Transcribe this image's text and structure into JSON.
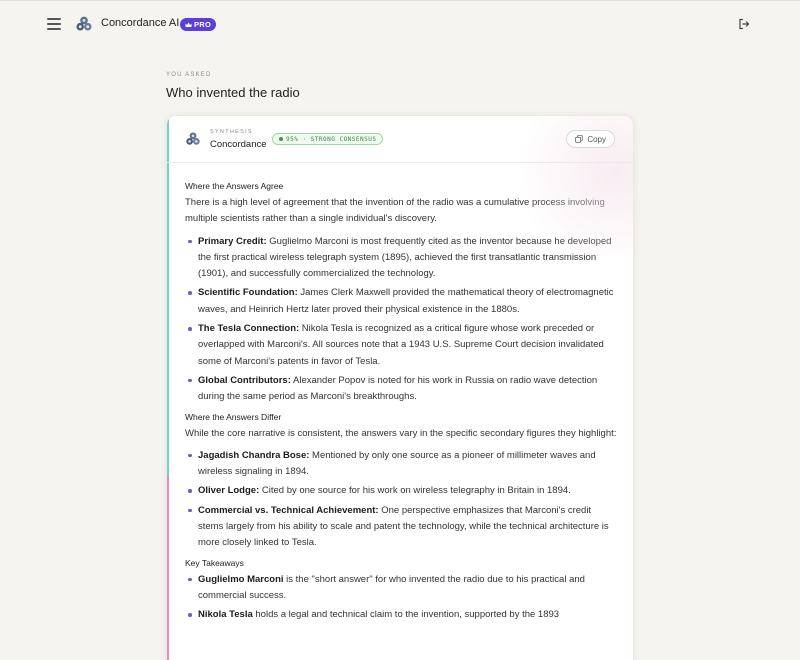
{
  "app": {
    "name": "Concordance AI",
    "badge": "PRO"
  },
  "query": {
    "label": "YOU ASKED",
    "text": "Who invented the radio"
  },
  "card": {
    "label": "SYNTHESIS",
    "title": "Concordance",
    "consensus": "95% · STRONG CONSENSUS",
    "copy_label": "Copy",
    "colors": {
      "top_rail": "#6fd4c7",
      "bottom_rail": "#e58ac0",
      "accent": "#5b3fd6"
    }
  },
  "sections": {
    "agree": {
      "heading": "Where the Answers Agree",
      "intro": "There is a high level of agreement that the invention of the radio was a cumulative process involving multiple scientists rather than a single individual's discovery.",
      "items": [
        {
          "term": "Primary Credit:",
          "text": " Guglielmo Marconi is most frequently cited as the inventor because he developed the first practical wireless telegraph system (1895), achieved the first transatlantic transmission (1901), and successfully commercialized the technology."
        },
        {
          "term": "Scientific Foundation:",
          "text": " James Clerk Maxwell provided the mathematical theory of electromagnetic waves, and Heinrich Hertz later proved their physical existence in the 1880s."
        },
        {
          "term": "The Tesla Connection:",
          "text": " Nikola Tesla is recognized as a critical figure whose work preceded or overlapped with Marconi's. All sources note that a 1943 U.S. Supreme Court decision invalidated some of Marconi's patents in favor of Tesla."
        },
        {
          "term": "Global Contributors:",
          "text": " Alexander Popov is noted for his work in Russia on radio wave detection during the same period as Marconi's breakthroughs."
        }
      ]
    },
    "differ": {
      "heading": "Where the Answers Differ",
      "intro": "While the core narrative is consistent, the answers vary in the specific secondary figures they highlight:",
      "items": [
        {
          "term": "Jagadish Chandra Bose:",
          "text": " Mentioned by only one source as a pioneer of millimeter waves and wireless signaling in 1894."
        },
        {
          "term": "Oliver Lodge:",
          "text": " Cited by one source for his work on wireless telegraphy in Britain in 1894."
        },
        {
          "term": "Commercial vs. Technical Achievement:",
          "text": " One perspective emphasizes that Marconi's credit stems largely from his ability to scale and patent the technology, while the technical architecture is more closely linked to Tesla."
        }
      ]
    },
    "takeaways": {
      "heading": "Key Takeaways",
      "items": [
        {
          "term": "Guglielmo Marconi",
          "text": " is the \"short answer\" for who invented the radio due to his practical and commercial success."
        },
        {
          "term": "Nikola Tesla",
          "text": " holds a legal and technical claim to the invention, supported by the 1893"
        }
      ]
    }
  }
}
